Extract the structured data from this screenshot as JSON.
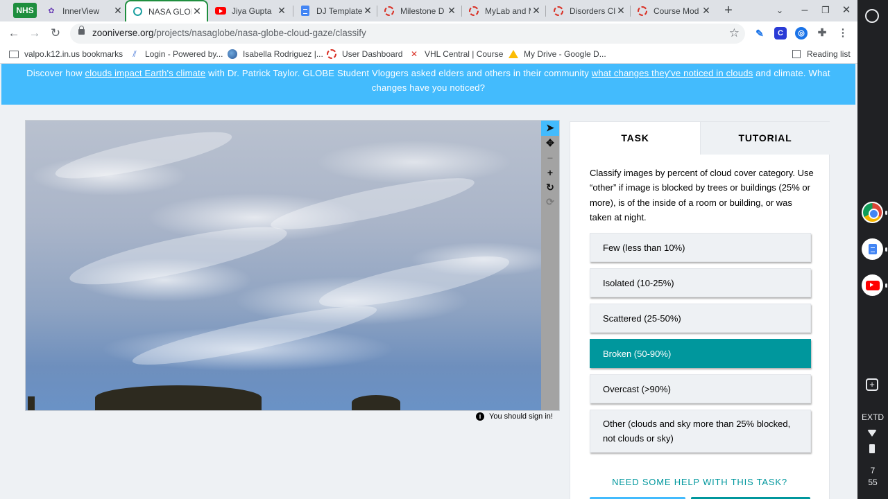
{
  "browser": {
    "badge": "NHS",
    "tabs": [
      {
        "title": "InnerView",
        "icon": "innerview-icon"
      },
      {
        "title": "NASA GLOBE",
        "icon": "zooniverse-icon",
        "active": true
      },
      {
        "title": "Jiya Gupta",
        "icon": "youtube-icon"
      },
      {
        "title": "DJ Template",
        "icon": "docs-icon"
      },
      {
        "title": "Milestone D",
        "icon": "ring-icon"
      },
      {
        "title": "MyLab and M",
        "icon": "ring-icon"
      },
      {
        "title": "Disorders Cl",
        "icon": "ring-icon"
      },
      {
        "title": "Course Mod",
        "icon": "ring-icon"
      }
    ],
    "url_host": "zooniverse.org",
    "url_path": "/projects/nasaglobe/nasa-globe-cloud-gaze/classify",
    "bookmarks": [
      {
        "label": "valpo.k12.in.us bookmarks"
      },
      {
        "label": "Login - Powered by..."
      },
      {
        "label": "Isabella Rodriguez |..."
      },
      {
        "label": "User Dashboard"
      },
      {
        "label": "VHL Central | Course"
      },
      {
        "label": "My Drive - Google D..."
      }
    ],
    "reading_list": "Reading list"
  },
  "banner": {
    "p1": "Discover how ",
    "link1": "clouds impact Earth's climate",
    "p2": " with Dr. Patrick Taylor. GLOBE Student Vloggers asked elders and others in their community ",
    "link2": "what changes they've noticed in clouds",
    "p3": " and climate. What changes have you noticed?"
  },
  "viewer": {
    "signin_note": "You should sign in!"
  },
  "task_panel": {
    "tabs": [
      "TASK",
      "TUTORIAL"
    ],
    "instructions": "Classify images by percent of cloud cover category. Use “other” if image is blocked by trees or buildings (25% or more), is of the inside of a room or building, or was taken at night.",
    "answers": [
      "Few (less than 10%)",
      "Isolated (10-25%)",
      "Scattered (25-50%)",
      "Broken (50-90%)",
      "Overcast (>90%)",
      "Other (clouds and sky more than 25% blocked, not clouds or sky)"
    ],
    "selected_answer": "Broken (50-90%)",
    "help_link": "NEED SOME HELP WITH THIS TASK?"
  },
  "shelf": {
    "status_label": "EXTD",
    "time_hour": "7",
    "time_minute": "55"
  },
  "colors": {
    "banner": "#43bbfd",
    "accent_teal": "#00979d",
    "active_tab_border": "#1e8e3e"
  }
}
